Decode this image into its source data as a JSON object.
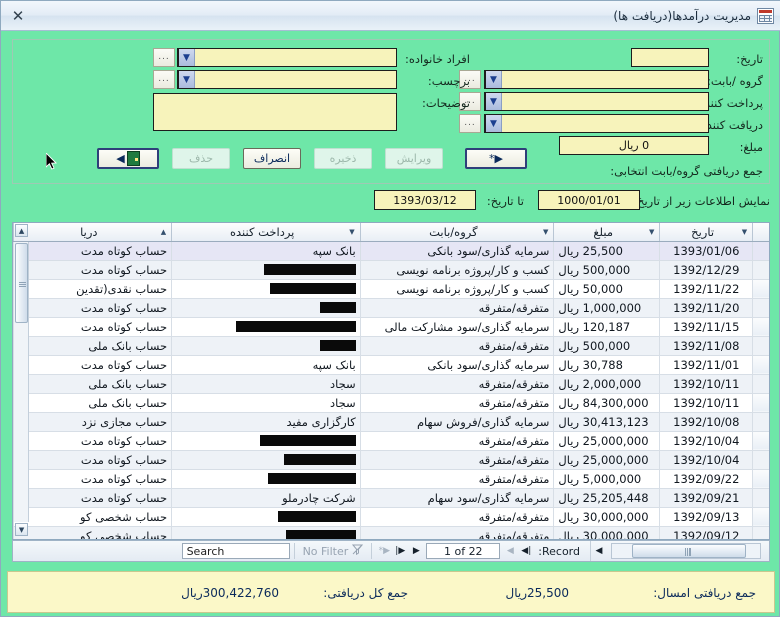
{
  "window": {
    "title": "مديريت درآمدها(دريافت ها)",
    "icon": "table-form-icon",
    "close_label": "✕"
  },
  "form": {
    "fields": {
      "date_label": "تاریخ:",
      "date_value": "",
      "group_label": "گروه /بابت:",
      "group_value": "",
      "payer_label": "پرداخت کننده",
      "payer_value": "",
      "receiver_label": "دریافت کننده",
      "receiver_value": "",
      "amount_label": "مبلغ:",
      "amount_value": "0 ریال",
      "family_label": "افراد خانواده:",
      "family_value": "",
      "tag_label": "برچسب:",
      "tag_value": "",
      "notes_label": "توضیحات:",
      "notes_value": "",
      "ellipsis_label": "...",
      "dropdown_glyph": "▼"
    },
    "group_total_label": "جمع دریافتی گروه/بابت انتخابی:",
    "buttons": [
      {
        "name": "exit",
        "label": "",
        "icon": "exit-door-icon",
        "state": "focused"
      },
      {
        "name": "delete",
        "label": "حذف",
        "state": "disabled"
      },
      {
        "name": "cancel",
        "label": "انصراف",
        "state": "enabled"
      },
      {
        "name": "save",
        "label": "ذخیره",
        "state": "disabled"
      },
      {
        "name": "edit",
        "label": "ویرایش",
        "state": "disabled"
      },
      {
        "name": "new",
        "label": "▶*",
        "state": "focused"
      }
    ]
  },
  "filter": {
    "from_label": "نمایش اطلاعات زیر از تاریخ:",
    "from_value": "1000/01/01",
    "to_label": "تا تاریخ:",
    "to_value": "1393/03/12"
  },
  "grid": {
    "columns": [
      "تاریخ",
      "مبلغ",
      "گروه/بابت",
      "پرداخت کننده",
      "دریا"
    ],
    "rows": [
      {
        "date": "1393/01/06",
        "amount": "25,500 ریال",
        "group": "سرمایه گذاری/سود بانکی",
        "payer": "بانک سپه",
        "payer_redacted": 0,
        "receiver": "حساب کوتاه مدت ",
        "selected": true
      },
      {
        "date": "1392/12/29",
        "amount": "500,000 ریال",
        "group": "کسب و کار/پروژه برنامه نویسی",
        "payer": "",
        "payer_redacted": 92,
        "receiver": "حساب کوتاه مدت "
      },
      {
        "date": "1392/11/22",
        "amount": "50,000 ریال",
        "group": "کسب و کار/پروژه برنامه نویسی",
        "payer": "",
        "payer_redacted": 86,
        "receiver": "حساب نقدی(تقدین"
      },
      {
        "date": "1392/11/20",
        "amount": "1,000,000 ریال",
        "group": "متفرقه/متفرقه",
        "payer": "",
        "payer_redacted": 36,
        "receiver": "حساب کوتاه مدت "
      },
      {
        "date": "1392/11/15",
        "amount": "120,187 ریال",
        "group": "سرمایه گذاری/سود مشارکت مالی",
        "payer": "",
        "payer_redacted": 120,
        "receiver": "حساب کوتاه مدت "
      },
      {
        "date": "1392/11/08",
        "amount": "500,000 ریال",
        "group": "متفرقه/متفرقه",
        "payer": "",
        "payer_redacted": 36,
        "receiver": "حساب بانک ملی"
      },
      {
        "date": "1392/11/01",
        "amount": "30,788 ریال",
        "group": "سرمایه گذاری/سود بانکی",
        "payer": "بانک سپه",
        "payer_redacted": 0,
        "receiver": "حساب کوتاه مدت "
      },
      {
        "date": "1392/10/11",
        "amount": "2,000,000 ریال",
        "group": "متفرقه/متفرقه",
        "payer": "سجاد",
        "payer_redacted": 0,
        "receiver": "حساب بانک ملی"
      },
      {
        "date": "1392/10/11",
        "amount": "84,300,000 ریال",
        "group": "متفرقه/متفرقه",
        "payer": "سجاد",
        "payer_redacted": 0,
        "receiver": "حساب بانک ملی"
      },
      {
        "date": "1392/10/08",
        "amount": "30,413,123 ریال",
        "group": "سرمایه گذاری/فروش سهام",
        "payer": "کارگزاری مفید",
        "payer_redacted": 0,
        "receiver": "حساب مجازی نزد "
      },
      {
        "date": "1392/10/04",
        "amount": "25,000,000 ریال",
        "group": "متفرقه/متفرقه",
        "payer": "",
        "payer_redacted": 96,
        "receiver": "حساب کوتاه مدت "
      },
      {
        "date": "1392/10/04",
        "amount": "25,000,000 ریال",
        "group": "متفرقه/متفرقه",
        "payer": "",
        "payer_redacted": 72,
        "receiver": "حساب کوتاه مدت "
      },
      {
        "date": "1392/09/22",
        "amount": "5,000,000 ریال",
        "group": "متفرقه/متفرقه",
        "payer": "",
        "payer_redacted": 88,
        "receiver": "حساب کوتاه مدت "
      },
      {
        "date": "1392/09/21",
        "amount": "25,205,448 ریال",
        "group": "سرمایه گذاری/سود سهام",
        "payer": "شرکت چادرملو",
        "payer_redacted": 0,
        "receiver": "حساب کوتاه مدت "
      },
      {
        "date": "1392/09/13",
        "amount": "30,000,000 ریال",
        "group": "متفرقه/متفرقه",
        "payer": "",
        "payer_redacted": 78,
        "receiver": "حساب شخصی کو"
      },
      {
        "date": "1392/09/12",
        "amount": "30,000,000 ریال",
        "group": "متفرقه/متفرقه",
        "payer": "",
        "payer_redacted": 70,
        "receiver": "حساب شخصی کو"
      }
    ]
  },
  "navbar": {
    "record_label": "Record:",
    "position": "1 of 22",
    "first_glyph": "|◀",
    "prev_glyph": "◀",
    "next_glyph": "▶",
    "last_glyph": "▶|",
    "new_glyph": "▶*",
    "filter_label": "No Filter",
    "filter_icon": "funnel-icon",
    "search_placeholder": "Search"
  },
  "summary": {
    "year_label": "جمع دریافتی امسال:",
    "year_value": "25,500ریال",
    "total_label": "جمع کل دریافتی:",
    "total_value": "300,422,760ریال"
  }
}
